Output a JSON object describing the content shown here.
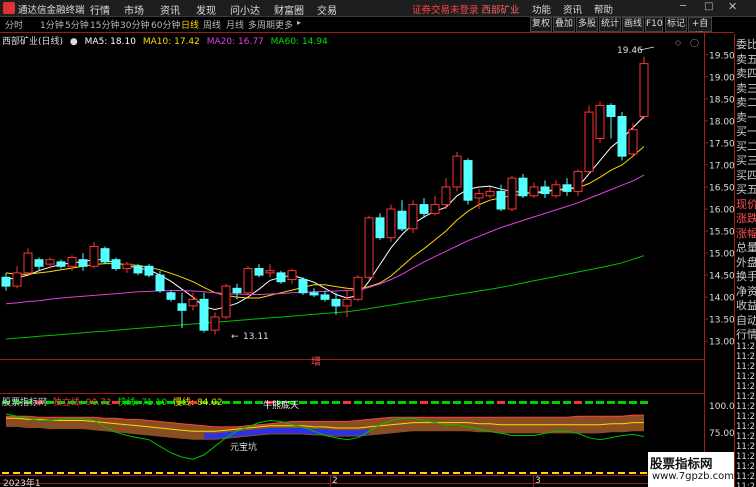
{
  "app": {
    "title": "通达信金融终端",
    "menus": [
      "行情",
      "市场",
      "资讯",
      "发现",
      "问小达",
      "财富圈",
      "交易"
    ],
    "notice": "证券交易未登录",
    "stock_name": "西部矿业",
    "right_menus": [
      "功能",
      "资讯",
      "帮助"
    ]
  },
  "toolbar": {
    "periods": [
      "分时",
      "1分钟",
      "5分钟",
      "15分钟",
      "30分钟",
      "60分钟",
      "日线",
      "周线",
      "月线",
      "多周期",
      "更多"
    ],
    "active_period": "日线",
    "right_tools": [
      "复权",
      "叠加",
      "多股",
      "统计",
      "画线",
      "F10",
      "标记",
      "+自选"
    ]
  },
  "legend": {
    "title": "西部矿业(日线)",
    "ma5_label": "MA5: 18.10",
    "ma10_label": "MA10: 17.42",
    "ma20_label": "MA20: 16.77",
    "ma60_label": "MA60: 14.94"
  },
  "indicator": {
    "name": "股票指标网",
    "line1": "独立线: 90.72",
    "line2": "快线: 71.10",
    "line3": "慢线: 84.02",
    "annot_mid": "牛熊底天",
    "annot_low": "元宝坑",
    "yticks": [
      "100.00",
      "75.00",
      "50.00"
    ]
  },
  "annotations": {
    "high": "19.46",
    "low": "13.11",
    "zeng": "增"
  },
  "price_axis": [
    "19.50",
    "19.00",
    "18.50",
    "18.00",
    "17.50",
    "17.00",
    "16.50",
    "16.00",
    "15.50",
    "15.00",
    "14.50",
    "14.00",
    "13.50",
    "13.00"
  ],
  "right_panel": {
    "labels": [
      "委比",
      "卖五",
      "卖四",
      "卖三",
      "卖二",
      "卖一",
      "买一",
      "买二",
      "买三",
      "买四",
      "买五",
      "现价",
      "涨跌",
      "涨幅",
      "总量",
      "外盘",
      "换手",
      "净资",
      "收益",
      "自动",
      "行情"
    ],
    "times": [
      "11:2",
      "11:2",
      "11:2",
      "11:2",
      "11:2",
      "11:2",
      "11:2",
      "11:2",
      "11:2",
      "11:2",
      "11:2",
      "11:2",
      "11:2",
      "11:2",
      "11:2"
    ]
  },
  "date_labels": [
    "2023年1",
    "2",
    "3"
  ],
  "watermark": {
    "line1": "股票指标网",
    "line2": "www.7gpzb.com"
  },
  "colors": {
    "up": "#ff3232",
    "down": "#54ffff",
    "ma5": "#ffffff",
    "ma10": "#ffd800",
    "ma20": "#e040e0",
    "ma60": "#00c000"
  },
  "chart_data": {
    "type": "candlestick",
    "price_range": [
      12.8,
      19.7
    ],
    "candles": [
      {
        "o": 14.45,
        "c": 14.25,
        "h": 14.55,
        "l": 14.15
      },
      {
        "o": 14.25,
        "c": 14.55,
        "h": 14.7,
        "l": 14.2
      },
      {
        "o": 14.55,
        "c": 15.0,
        "h": 15.1,
        "l": 14.5
      },
      {
        "o": 14.85,
        "c": 14.7,
        "h": 14.9,
        "l": 14.6
      },
      {
        "o": 14.75,
        "c": 14.85,
        "h": 14.9,
        "l": 14.65
      },
      {
        "o": 14.8,
        "c": 14.7,
        "h": 14.85,
        "l": 14.65
      },
      {
        "o": 14.7,
        "c": 14.9,
        "h": 14.95,
        "l": 14.6
      },
      {
        "o": 14.85,
        "c": 14.7,
        "h": 15.0,
        "l": 14.6
      },
      {
        "o": 14.7,
        "c": 15.15,
        "h": 15.25,
        "l": 14.65
      },
      {
        "o": 15.1,
        "c": 14.8,
        "h": 15.15,
        "l": 14.75
      },
      {
        "o": 14.85,
        "c": 14.65,
        "h": 14.9,
        "l": 14.6
      },
      {
        "o": 14.65,
        "c": 14.75,
        "h": 14.8,
        "l": 14.55
      },
      {
        "o": 14.7,
        "c": 14.55,
        "h": 14.75,
        "l": 14.5
      },
      {
        "o": 14.7,
        "c": 14.5,
        "h": 14.75,
        "l": 14.45
      },
      {
        "o": 14.5,
        "c": 14.15,
        "h": 14.6,
        "l": 14.1
      },
      {
        "o": 14.1,
        "c": 13.95,
        "h": 14.15,
        "l": 13.9
      },
      {
        "o": 13.85,
        "c": 13.7,
        "h": 14.1,
        "l": 13.3
      },
      {
        "o": 13.8,
        "c": 13.95,
        "h": 14.1,
        "l": 13.7
      },
      {
        "o": 13.95,
        "c": 13.25,
        "h": 14.1,
        "l": 13.2
      },
      {
        "o": 13.25,
        "c": 13.55,
        "h": 13.65,
        "l": 13.15
      },
      {
        "o": 13.55,
        "c": 14.25,
        "h": 14.3,
        "l": 13.5
      },
      {
        "o": 14.2,
        "c": 14.1,
        "h": 14.3,
        "l": 13.95
      },
      {
        "o": 14.1,
        "c": 14.65,
        "h": 14.7,
        "l": 14.05
      },
      {
        "o": 14.65,
        "c": 14.5,
        "h": 14.75,
        "l": 14.45
      },
      {
        "o": 14.55,
        "c": 14.6,
        "h": 14.75,
        "l": 14.45
      },
      {
        "o": 14.55,
        "c": 14.35,
        "h": 14.6,
        "l": 14.3
      },
      {
        "o": 14.4,
        "c": 14.6,
        "h": 14.65,
        "l": 14.3
      },
      {
        "o": 14.4,
        "c": 14.1,
        "h": 14.45,
        "l": 14.05
      },
      {
        "o": 14.1,
        "c": 14.05,
        "h": 14.2,
        "l": 14.0
      },
      {
        "o": 14.05,
        "c": 13.95,
        "h": 14.15,
        "l": 13.9
      },
      {
        "o": 13.95,
        "c": 13.8,
        "h": 14.1,
        "l": 13.6
      },
      {
        "o": 13.8,
        "c": 13.95,
        "h": 14.15,
        "l": 13.55
      },
      {
        "o": 13.95,
        "c": 14.45,
        "h": 14.5,
        "l": 13.9
      },
      {
        "o": 14.45,
        "c": 15.8,
        "h": 15.85,
        "l": 14.4
      },
      {
        "o": 15.8,
        "c": 15.35,
        "h": 15.9,
        "l": 15.3
      },
      {
        "o": 15.35,
        "c": 16.0,
        "h": 16.1,
        "l": 15.25
      },
      {
        "o": 15.95,
        "c": 15.55,
        "h": 16.2,
        "l": 15.5
      },
      {
        "o": 15.55,
        "c": 16.1,
        "h": 16.2,
        "l": 15.45
      },
      {
        "o": 16.1,
        "c": 15.9,
        "h": 16.25,
        "l": 15.8
      },
      {
        "o": 15.9,
        "c": 16.1,
        "h": 16.3,
        "l": 15.85
      },
      {
        "o": 16.1,
        "c": 16.5,
        "h": 16.7,
        "l": 16.0
      },
      {
        "o": 16.5,
        "c": 17.2,
        "h": 17.3,
        "l": 16.4
      },
      {
        "o": 17.1,
        "c": 16.2,
        "h": 17.15,
        "l": 16.1
      },
      {
        "o": 16.25,
        "c": 16.35,
        "h": 16.45,
        "l": 16.0
      },
      {
        "o": 16.3,
        "c": 16.4,
        "h": 16.5,
        "l": 16.25
      },
      {
        "o": 16.4,
        "c": 16.0,
        "h": 16.55,
        "l": 15.95
      },
      {
        "o": 16.0,
        "c": 16.7,
        "h": 16.75,
        "l": 15.95
      },
      {
        "o": 16.7,
        "c": 16.3,
        "h": 16.8,
        "l": 16.25
      },
      {
        "o": 16.3,
        "c": 16.5,
        "h": 16.6,
        "l": 16.25
      },
      {
        "o": 16.5,
        "c": 16.35,
        "h": 16.65,
        "l": 16.25
      },
      {
        "o": 16.3,
        "c": 16.55,
        "h": 16.65,
        "l": 16.25
      },
      {
        "o": 16.55,
        "c": 16.4,
        "h": 16.7,
        "l": 16.3
      },
      {
        "o": 16.4,
        "c": 16.85,
        "h": 16.9,
        "l": 16.3
      },
      {
        "o": 16.85,
        "c": 18.2,
        "h": 18.35,
        "l": 16.8
      },
      {
        "o": 17.6,
        "c": 18.35,
        "h": 18.45,
        "l": 17.5
      },
      {
        "o": 18.35,
        "c": 18.1,
        "h": 18.4,
        "l": 17.6
      },
      {
        "o": 18.1,
        "c": 17.2,
        "h": 18.2,
        "l": 17.1
      },
      {
        "o": 17.25,
        "c": 17.8,
        "h": 17.95,
        "l": 17.2
      },
      {
        "o": 18.1,
        "c": 19.3,
        "h": 19.46,
        "l": 18.05
      }
    ],
    "ma": [
      {
        "name": "MA5",
        "values": [
          14.4,
          14.44,
          14.5,
          14.6,
          14.68,
          14.74,
          14.78,
          14.8,
          14.86,
          14.84,
          14.78,
          14.72,
          14.66,
          14.62,
          14.5,
          14.36,
          14.18,
          14.0,
          13.78,
          13.72,
          13.78,
          13.86,
          14.0,
          14.18,
          14.38,
          14.45,
          14.5,
          14.42,
          14.34,
          14.2,
          14.06,
          13.98,
          14.04,
          14.36,
          14.74,
          15.12,
          15.42,
          15.66,
          15.82,
          15.95,
          16.04,
          16.3,
          16.45,
          16.5,
          16.52,
          16.45,
          16.4,
          16.38,
          16.35,
          16.4,
          16.45,
          16.45,
          16.5,
          16.8,
          17.1,
          17.4,
          17.6,
          17.85,
          18.1
        ]
      },
      {
        "name": "MA10",
        "values": [
          14.55,
          14.52,
          14.52,
          14.55,
          14.58,
          14.62,
          14.66,
          14.7,
          14.74,
          14.76,
          14.76,
          14.74,
          14.72,
          14.68,
          14.62,
          14.54,
          14.45,
          14.35,
          14.22,
          14.1,
          14.04,
          14.0,
          13.98,
          13.98,
          14.04,
          14.1,
          14.16,
          14.22,
          14.28,
          14.28,
          14.24,
          14.2,
          14.18,
          14.24,
          14.32,
          14.48,
          14.7,
          14.92,
          15.1,
          15.3,
          15.5,
          15.75,
          15.95,
          16.1,
          16.2,
          16.26,
          16.3,
          16.34,
          16.38,
          16.4,
          16.42,
          16.45,
          16.48,
          16.58,
          16.72,
          16.88,
          17.0,
          17.2,
          17.42
        ]
      },
      {
        "name": "MA20",
        "values": [
          13.85,
          13.87,
          13.9,
          13.92,
          13.95,
          13.98,
          14.0,
          14.02,
          14.04,
          14.06,
          14.08,
          14.1,
          14.12,
          14.13,
          14.14,
          14.15,
          14.15,
          14.14,
          14.12,
          14.1,
          14.08,
          14.07,
          14.06,
          14.06,
          14.07,
          14.08,
          14.1,
          14.11,
          14.12,
          14.13,
          14.14,
          14.15,
          14.16,
          14.22,
          14.3,
          14.4,
          14.52,
          14.66,
          14.8,
          14.92,
          15.04,
          15.16,
          15.28,
          15.38,
          15.48,
          15.58,
          15.66,
          15.74,
          15.82,
          15.9,
          15.98,
          16.06,
          16.14,
          16.24,
          16.34,
          16.44,
          16.54,
          16.64,
          16.77
        ]
      },
      {
        "name": "MA60",
        "values": [
          13.05,
          13.07,
          13.09,
          13.11,
          13.13,
          13.15,
          13.17,
          13.19,
          13.21,
          13.23,
          13.25,
          13.27,
          13.29,
          13.31,
          13.33,
          13.35,
          13.37,
          13.39,
          13.41,
          13.43,
          13.45,
          13.47,
          13.49,
          13.51,
          13.53,
          13.55,
          13.57,
          13.59,
          13.61,
          13.63,
          13.65,
          13.67,
          13.7,
          13.74,
          13.78,
          13.82,
          13.86,
          13.9,
          13.94,
          13.98,
          14.02,
          14.06,
          14.1,
          14.14,
          14.18,
          14.22,
          14.27,
          14.32,
          14.37,
          14.42,
          14.47,
          14.52,
          14.57,
          14.62,
          14.67,
          14.72,
          14.78,
          14.86,
          14.94
        ]
      }
    ],
    "indicator_range": [
      40,
      105
    ],
    "fast_line": [
      92,
      90,
      88,
      86,
      86,
      87,
      88,
      88,
      86,
      80,
      75,
      72,
      70,
      68,
      62,
      56,
      52,
      50,
      54,
      62,
      70,
      76,
      80,
      84,
      86,
      85,
      82,
      80,
      76,
      72,
      70,
      68,
      70,
      76,
      82,
      86,
      88,
      88,
      86,
      84,
      82,
      82,
      80,
      78,
      76,
      74,
      72,
      72,
      72,
      74,
      76,
      76,
      74,
      70,
      68,
      70,
      72,
      73,
      71
    ],
    "slow_line": [
      88,
      88,
      87,
      87,
      86,
      86,
      86,
      86,
      85,
      84,
      83,
      82,
      81,
      80,
      79,
      78,
      77,
      76,
      76,
      76,
      77,
      78,
      79,
      80,
      81,
      81,
      81,
      81,
      80,
      80,
      79,
      79,
      79,
      80,
      81,
      82,
      83,
      84,
      84,
      84,
      84,
      84,
      84,
      83,
      83,
      82,
      82,
      82,
      82,
      82,
      82,
      82,
      82,
      82,
      82,
      83,
      83,
      84,
      84
    ],
    "independent_line": [
      90,
      90,
      90,
      89,
      89,
      89,
      89,
      89,
      89,
      88,
      88,
      87,
      87,
      86,
      85,
      84,
      83,
      82,
      81,
      80,
      80,
      80,
      81,
      82,
      83,
      84,
      85,
      85,
      85,
      85,
      85,
      85,
      86,
      87,
      88,
      89,
      89,
      89,
      89,
      89,
      89,
      89,
      89,
      89,
      89,
      89,
      89,
      89,
      89,
      89,
      89,
      89,
      90,
      90,
      90,
      90,
      90,
      91,
      91
    ]
  }
}
